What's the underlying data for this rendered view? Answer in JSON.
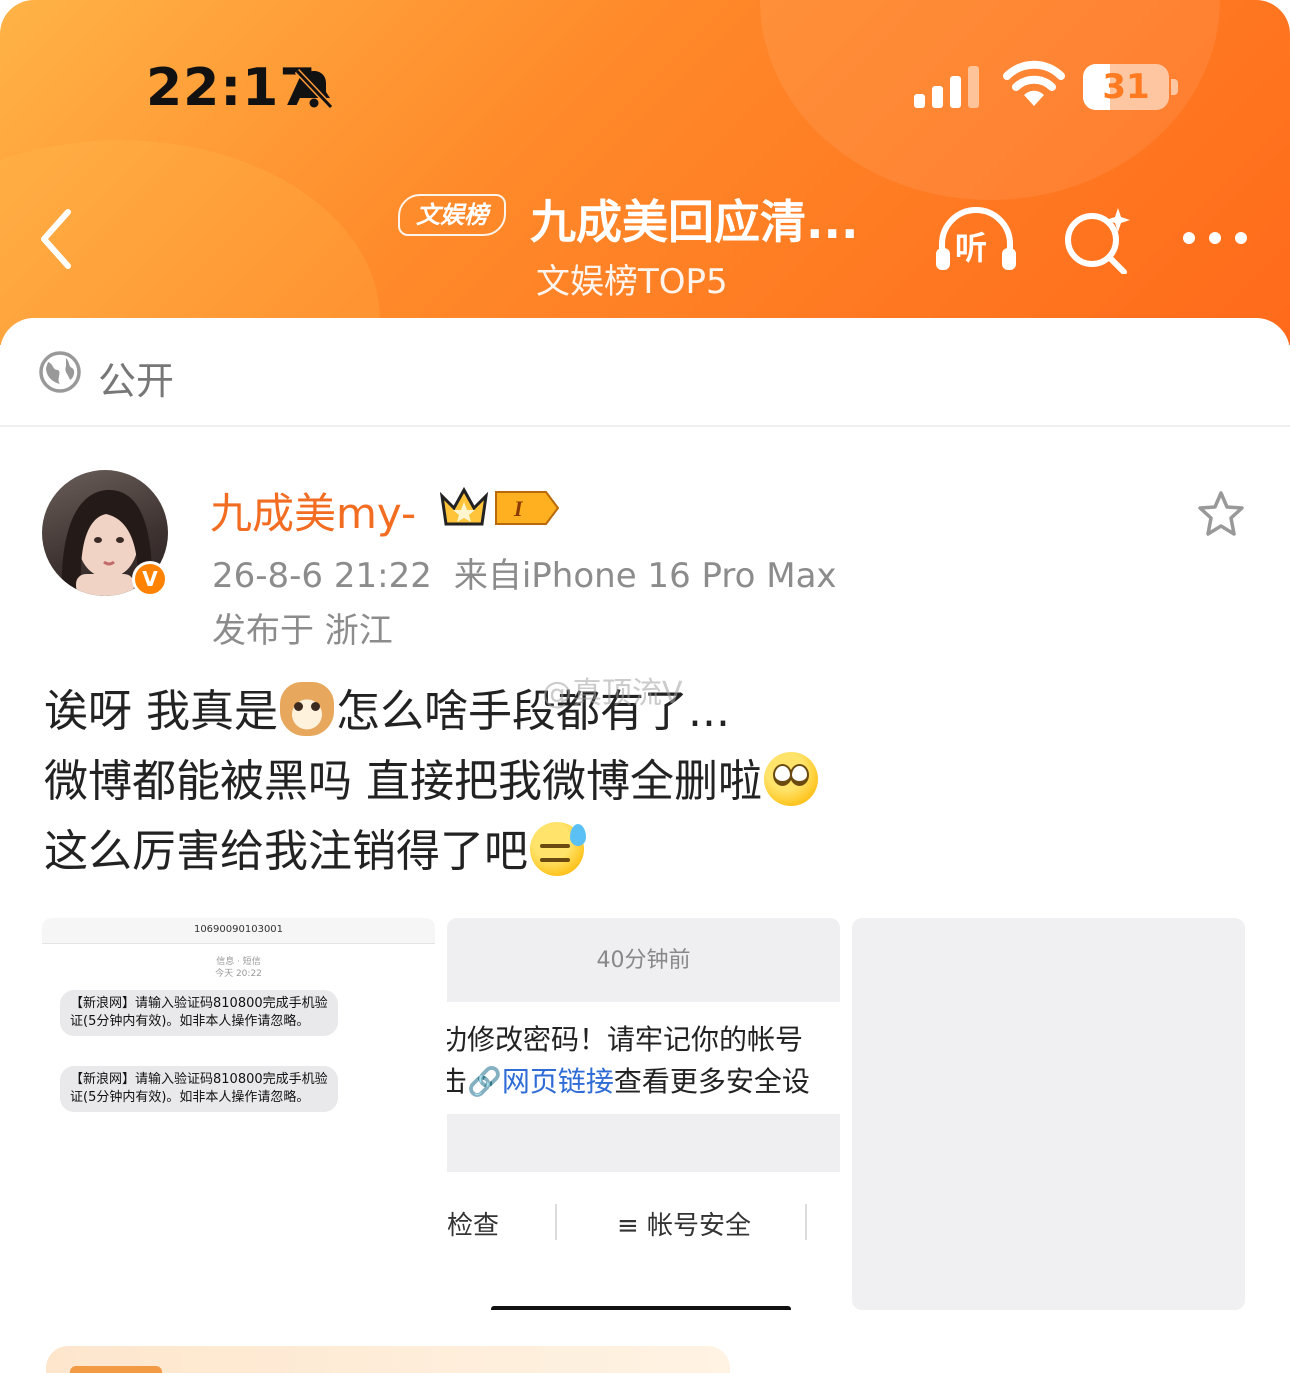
{
  "status_bar": {
    "time": "22:17",
    "icons": [
      "bell-slash-icon",
      "signal-icon",
      "wifi-icon",
      "battery-icon"
    ],
    "battery": "31",
    "battery_level": 0.31
  },
  "nav": {
    "badge": "文娱榜",
    "title": "九成美回应清...",
    "subtitle": "文娱榜TOP5",
    "listen_label": "听",
    "icons": [
      "back-icon",
      "listen-icon",
      "search-icon",
      "more-icon"
    ]
  },
  "visibility": {
    "label": "公开",
    "icon": "globe-icon"
  },
  "post": {
    "author": "九成美my-",
    "verified_icon": "verified-v-icon",
    "date": "26-8-6 21:22",
    "source": "来自iPhone 16 Pro Max",
    "location": "发布于 浙江",
    "lines": [
      {
        "text_a": "诶呀 我真是",
        "emoji": "dog-emoji",
        "text_b": "怎么啥手段都有了..."
      },
      {
        "text_a": "微博都能被黑吗 直接把我微博全删啦",
        "emoji": "eye-roll-emoji"
      },
      {
        "text_a": "这么厉害给我注销得了吧",
        "emoji": "sweat-emoji"
      }
    ],
    "watermark": "@真顶流V"
  },
  "images": {
    "sms": {
      "sender": "10690090103001",
      "meta_line1": "信息 · 短信",
      "meta_line2": "今天 20:22",
      "messages": [
        "【新浪网】请输入验证码810800完成手机验证(5分钟内有效)。如非本人操作请忽略。",
        "【新浪网】请输入验证码810800完成手机验证(5分钟内有效)。如非本人操作请忽略。"
      ]
    },
    "notice": {
      "time": "40分钟前",
      "line1": "功修改密码！请牢记你的帐号",
      "line2_pre": "击",
      "line2_link": "🔗网页链接",
      "line2_post": "查看更多安全设",
      "tab1": "检查",
      "tab2": "≡ 帐号安全"
    }
  },
  "colors": {
    "header_orange": "#ff7a20",
    "username": "#f26c21",
    "link": "#2f6cd6",
    "meta_gray": "#8c8c8c"
  }
}
